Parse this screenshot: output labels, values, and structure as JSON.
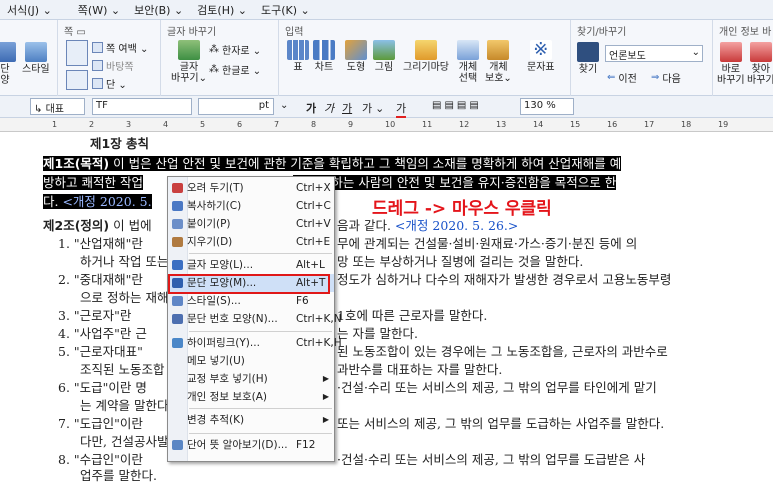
{
  "menubar": {
    "items": [
      "서식(J) ⌄",
      "쪽(W) ⌄",
      "보안(B) ⌄",
      "검토(H) ⌄",
      "도구(K) ⌄"
    ]
  },
  "ribbon": {
    "page_group": {
      "title": "쪽 ▭",
      "margin": "쪽 여백 ⌄",
      "bg": "바탕쪽",
      "col": "단 ⌄"
    },
    "style_left": [
      "단",
      "양"
    ],
    "style_label": "스타일",
    "font_change": {
      "title": "글자 바꾸기",
      "hanja": "한자로 ⌄",
      "hangul": "한글로 ⌄",
      "btn": "글자\n바꾸기⌄"
    },
    "insert": {
      "title": "입력",
      "items": [
        "표",
        "차트",
        "도형",
        "그림",
        "그리기마당",
        "개체\n선택",
        "개체\n보호⌄",
        "문자표"
      ]
    },
    "find": {
      "title": "찾기/바꾸기",
      "find": "찾기",
      "search": "언론보도",
      "prev": "이전",
      "next": "다음"
    },
    "privacy": {
      "title": "개인 정보 바",
      "btn1": "바로\n바꾸기",
      "btn2": "찾아\n바꾸기"
    }
  },
  "formatbar": {
    "style": "대표",
    "font": "TF",
    "pt": "pt",
    "size_ctrl": "⌄",
    "bold": "가",
    "italic": "가",
    "under": "가",
    "strike": "가",
    "color": "가",
    "zoom": "130",
    "pct": "%"
  },
  "ruler": {
    "ticks": [
      "1",
      "2",
      "3",
      "4",
      "5",
      "6",
      "7",
      "8",
      "9",
      "10",
      "11",
      "12",
      "13",
      "14",
      "15",
      "16",
      "17",
      "18",
      "19"
    ]
  },
  "doc": {
    "heading": "제1장 총칙",
    "art1_a": "제1조(목적)",
    "art1_b": " 이 법은 산업 안전 및 보건에 관한 기준을 확립하고 그 책임의 소재를 명확하게 하여 산업재해를 예",
    "art1_c": "방하고 쾌적한 작업",
    "art1_d": "을 제공하는 사람의 안전 및 보건을 유지·증진함을 목적으로 한",
    "art1_e": "다.",
    "art1_f": " <개정 2020. 5.",
    "art2_a": "제2조(정의)",
    "art2_b": " 이 법에",
    "art2_c": "음과 같다.",
    "art2_d": " <개정 2020. 5. 26.>",
    "l1a": "1.  \"산업재해\"란",
    "l1b": "무에 관계되는 건설물·설비·원재료·가스·증기·분진 등에 의",
    "l1c": "하거나 작업 또는",
    "l1d": "망 또는 부상하거나 질병에 걸리는 것을 말한다.",
    "l2a": "2.  \"중대재해\"란",
    "l2b": "정도가 심하거나 다수의 재해자가 발생한 경우로서 고용노동부령",
    "l2c": "으로 정하는 재해",
    "l3a": "3.  \"근로자\"란",
    "l3b": "1호에 따른 근로자를 말한다.",
    "l4a": "4.  \"사업주\"란 근",
    "l4b": "는 자를 말한다.",
    "l5a": "5.  \"근로자대표\"",
    "l5b": "된 노동조합이 있는 경우에는 그 노동조합을, 근로자의 과반수로",
    "l5c": "조직된 노동조합",
    "l5d": "과반수를 대표하는 자를 말한다.",
    "l6a": "6.  \"도급\"이란 명",
    "l6b": "·건설·수리 또는 서비스의 제공, 그 밖의 업무를 타인에게 맡기",
    "l6c": "는 계약을 말한다",
    "l7a": "7.  \"도급인\"이란",
    "l7b": "또는 서비스의 제공, 그 밖의 업무를 도급하는 사업주를 말한다.",
    "l7c": "다만, 건설공사발",
    "l8a": "8.  \"수급인\"이란",
    "l8b": "·건설·수리 또는 서비스의 제공, 그 밖의 업무를 도급받은 사",
    "l8c": "업주를 말한다."
  },
  "context_menu": {
    "items": [
      {
        "label": "오려 두기(T)",
        "shortcut": "Ctrl+X",
        "icon": "scissors-icon",
        "color": "#c94040"
      },
      {
        "label": "복사하기(C)",
        "shortcut": "Ctrl+C",
        "icon": "copy-icon",
        "color": "#4a78c4"
      },
      {
        "label": "붙이기(P)",
        "shortcut": "Ctrl+V",
        "icon": "paste-icon",
        "color": "#6c8fc9"
      },
      {
        "label": "지우기(D)",
        "shortcut": "Ctrl+E",
        "icon": "eraser-icon",
        "color": "#b07a40"
      },
      {
        "label": "글자 모양(L)...",
        "shortcut": "Alt+L",
        "icon": "char-shape-icon",
        "color": "#3b6fc2"
      },
      {
        "label": "문단 모양(M)...",
        "shortcut": "Alt+T",
        "icon": "para-shape-icon",
        "color": "#2f5fae"
      },
      {
        "label": "스타일(S)...",
        "shortcut": "F6",
        "icon": "style-icon",
        "color": "#5f86c6"
      },
      {
        "label": "문단 번호 모양(N)...",
        "shortcut": "Ctrl+K,N",
        "icon": "numbering-icon",
        "color": "#4d6fb0"
      },
      {
        "label": "하이퍼링크(Y)...",
        "shortcut": "Ctrl+K,H",
        "icon": "hyperlink-icon",
        "color": "#4b87c8"
      },
      {
        "label": "메모 넣기(U)",
        "shortcut": "",
        "icon": "",
        "color": ""
      },
      {
        "label": "교정 부호 넣기(H)",
        "shortcut": "",
        "icon": "",
        "color": ""
      },
      {
        "label": "개인 정보 보호(A)",
        "shortcut": "",
        "icon": "",
        "color": ""
      },
      {
        "label": "변경 추적(K)",
        "shortcut": "",
        "icon": "",
        "color": ""
      },
      {
        "label": "단어 뜻 알아보기(D)...",
        "shortcut": "F12",
        "icon": "dictionary-icon",
        "color": "#5a86c4"
      }
    ]
  },
  "annotation": "드레그 -> 마우스 우클릭",
  "colors": {
    "highlight_box": "#e01818",
    "annotation": "#e4151b",
    "link_blue": "#1a53c9"
  }
}
